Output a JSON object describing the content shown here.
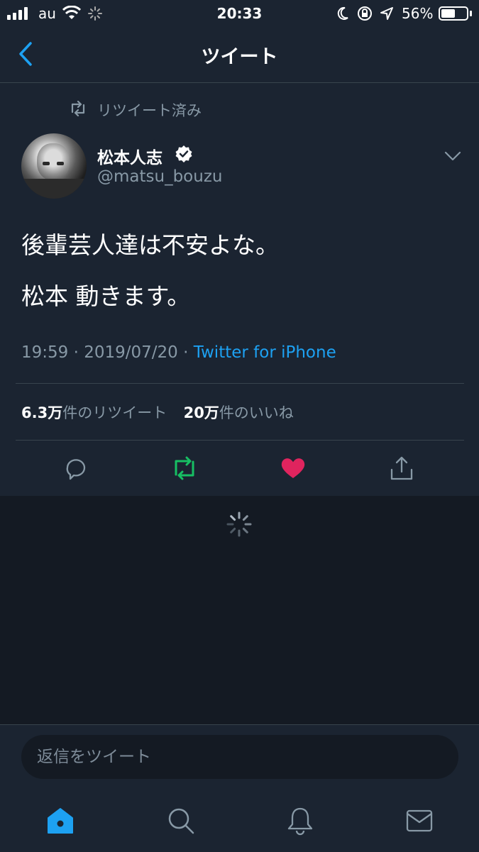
{
  "status_bar": {
    "carrier": "au",
    "time": "20:33",
    "battery_percent": "56%",
    "battery_level": 0.56
  },
  "nav": {
    "title": "ツイート",
    "back_icon": "chevron-left-icon"
  },
  "tweet": {
    "retweet_context": "リツイート済み",
    "author_name": "松本人志",
    "verified": true,
    "handle": "@matsu_bouzu",
    "lines": [
      "後輩芸人達は不安よな。",
      "松本 動きます。"
    ],
    "time": "19:59",
    "sep1": "·",
    "date": "2019/07/20",
    "sep2": "·",
    "source": "Twitter for iPhone",
    "retweet_count": "6.3万",
    "retweet_label": "件のリツイート",
    "like_count": "20万",
    "like_label": "件のいいね"
  },
  "actions": {
    "reply": "reply-icon",
    "retweet": "retweet-icon",
    "like": "heart-icon",
    "share": "share-icon"
  },
  "reply_box": {
    "placeholder": "返信をツイート"
  },
  "tab_bar": [
    "home-icon",
    "search-icon",
    "bell-icon",
    "mail-icon"
  ],
  "colors": {
    "accent": "#1da1f2",
    "retweet_green": "#17bf63",
    "like_red": "#e0245e",
    "background": "#141a23",
    "card": "#1b2431",
    "muted": "#8899a6"
  }
}
